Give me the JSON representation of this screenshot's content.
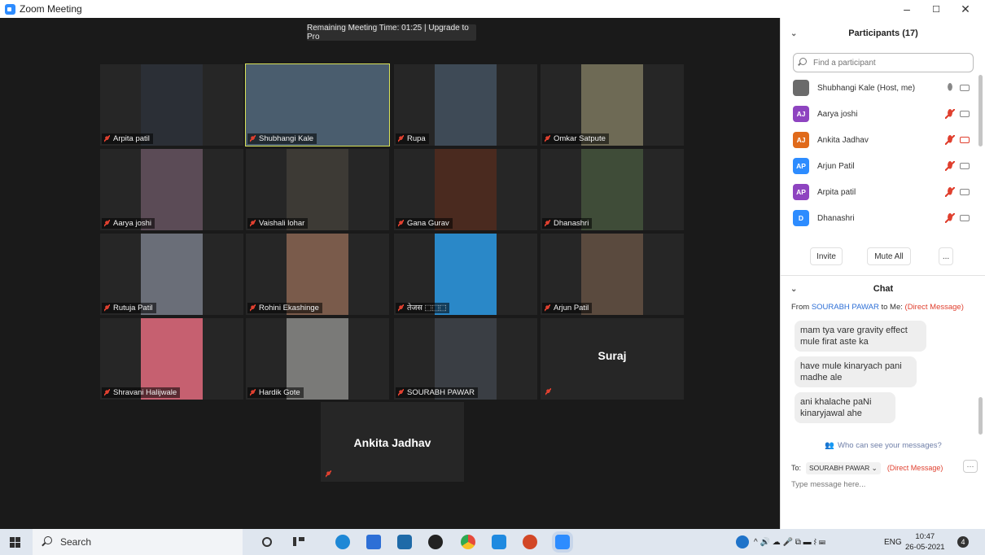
{
  "window": {
    "title": "Zoom Meeting",
    "min": "–",
    "max": "☐",
    "close": "✕"
  },
  "meeting": {
    "timer": "Remaining Meeting Time: 01:25 | Upgrade to Pro",
    "tiles": [
      {
        "name": "Arpita patil",
        "video_bg": "#2b2f36"
      },
      {
        "name": "Shubhangi Kale",
        "video_bg": "#4a5d6e",
        "active": true
      },
      {
        "name": "Rupa",
        "video_bg": "#3e4a56"
      },
      {
        "name": "Omkar Satpute",
        "video_bg": "#6e6a55"
      },
      {
        "name": "Aarya joshi",
        "video_bg": "#5b4b56"
      },
      {
        "name": "Vaishali lohar",
        "video_bg": "#3d3a35"
      },
      {
        "name": "Gana Gurav",
        "video_bg": "#4a2a1f"
      },
      {
        "name": "Dhanashri",
        "video_bg": "#3f4c38"
      },
      {
        "name": "Rutuja Patil",
        "video_bg": "#6a6e78"
      },
      {
        "name": "Rohini Ekashinge",
        "video_bg": "#7a5b4b"
      },
      {
        "name": "तेजस ⬚⬚⬚",
        "video_bg": "#2a88c8"
      },
      {
        "name": "Arjun Patil",
        "video_bg": "#5a4a3e"
      },
      {
        "name": "Shravani Halijwale",
        "video_bg": "#c66070"
      },
      {
        "name": "Hardik Gote",
        "video_bg": "#7a7a78"
      },
      {
        "name": "SOURABH PAWAR",
        "video_bg": "#3a3e44"
      },
      {
        "name": "",
        "bigname": "Suraj"
      }
    ],
    "last_tile": {
      "bigname": "Ankita Jadhav"
    }
  },
  "participants": {
    "header": "Participants (17)",
    "search_placeholder": "Find a participant",
    "items": [
      {
        "initials": "",
        "name": "Shubhangi Kale (Host, me)",
        "color": "#6b6b6b"
      },
      {
        "initials": "AJ",
        "name": "Aarya joshi",
        "color": "#8e44c0"
      },
      {
        "initials": "AJ",
        "name": "Ankita Jadhav",
        "color": "#e06a1b"
      },
      {
        "initials": "AP",
        "name": "Arjun Patil",
        "color": "#2d8cff"
      },
      {
        "initials": "AP",
        "name": "Arpita patil",
        "color": "#8e44c0"
      },
      {
        "initials": "D",
        "name": "Dhanashri",
        "color": "#2d8cff"
      },
      {
        "initials": "",
        "name": "",
        "color": "#2e4057"
      }
    ],
    "invite": "Invite",
    "mute_all": "Mute All",
    "more": "..."
  },
  "chat": {
    "header": "Chat",
    "from_prefix": "From",
    "from_name": "SOURABH PAWAR",
    "to_me": "to Me:",
    "direct": "(Direct Message)",
    "messages": [
      "mam tya vare  gravity effect mule  firat aste ka",
      "have mule kinaryach pani madhe ale",
      "ani khalache paNi kinaryjawal ahe"
    ],
    "who_can_see": "Who can see your messages?",
    "to_label": "To:",
    "to_value": "SOURABH PAWAR ⌄",
    "to_direct": "(Direct Message)",
    "more": "···",
    "placeholder": "Type message here..."
  },
  "taskbar": {
    "search": "Search",
    "lang": "ENG",
    "time": "10:47",
    "date": "26-05-2021",
    "notif": "4"
  },
  "colors": {
    "accent": "#2d8cff",
    "mute": "#e0402f",
    "active_border": "#d8e25a"
  }
}
